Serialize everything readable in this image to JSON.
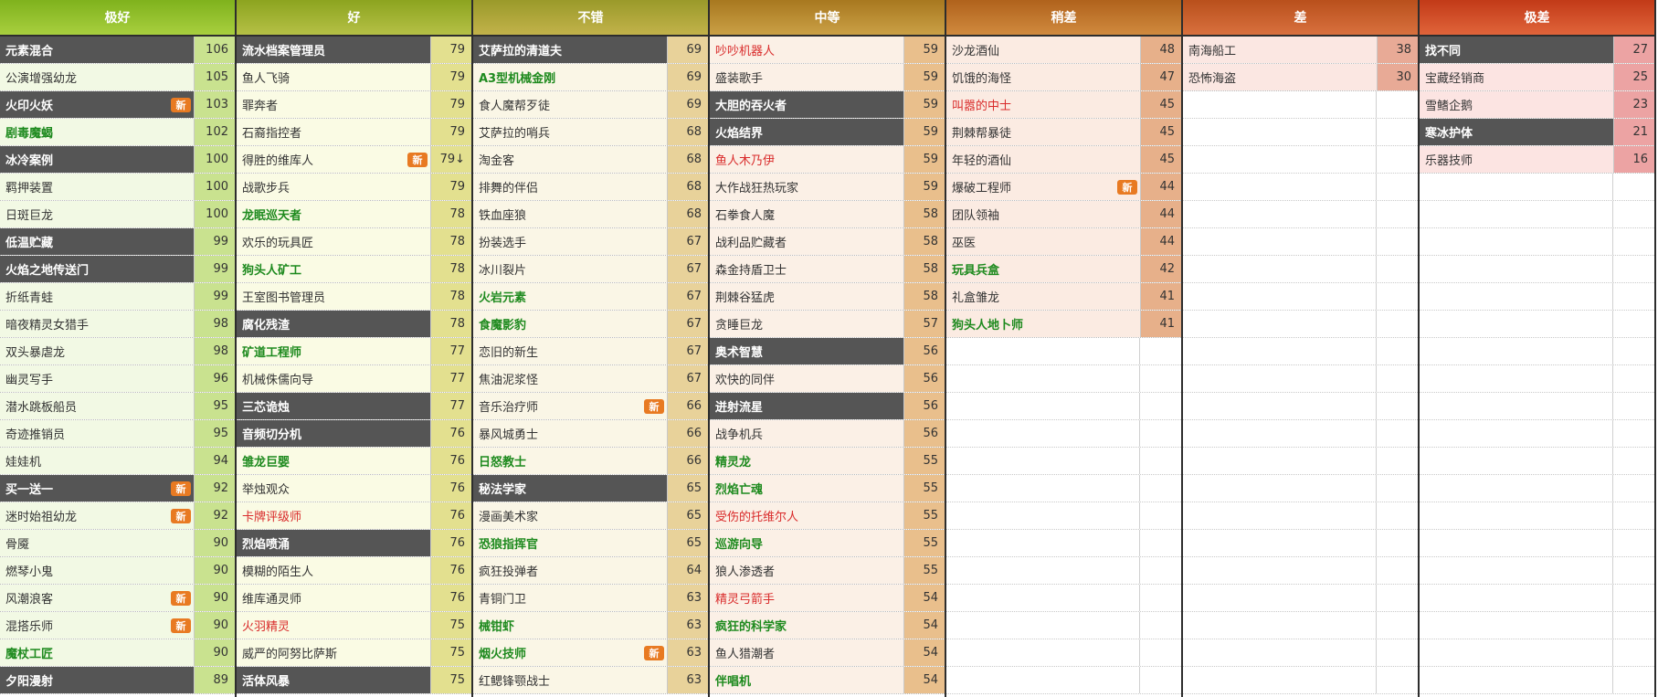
{
  "columns": [
    {
      "title": "极好",
      "header_gradient": [
        "#7fb21d",
        "#a8cf3e"
      ],
      "name_bg": "#f2f9e4",
      "score_bg": "#c9e28f",
      "rows": [
        {
          "name": "元素混合",
          "score": "106",
          "style": "dark",
          "badge": ""
        },
        {
          "name": "公演增强幼龙",
          "score": "105",
          "style": "normal",
          "badge": ""
        },
        {
          "name": "火印火妖",
          "score": "103",
          "style": "dark",
          "badge": "新"
        },
        {
          "name": "剧毒魔蝎",
          "score": "102",
          "style": "green",
          "badge": ""
        },
        {
          "name": "冰冷案例",
          "score": "100",
          "style": "dark",
          "badge": ""
        },
        {
          "name": "羁押装置",
          "score": "100",
          "style": "normal",
          "badge": ""
        },
        {
          "name": "日斑巨龙",
          "score": "100",
          "style": "normal",
          "badge": ""
        },
        {
          "name": "低温贮藏",
          "score": "99",
          "style": "dark",
          "badge": ""
        },
        {
          "name": "火焰之地传送门",
          "score": "99",
          "style": "dark",
          "badge": ""
        },
        {
          "name": "折纸青蛙",
          "score": "99",
          "style": "normal",
          "badge": ""
        },
        {
          "name": "暗夜精灵女猎手",
          "score": "98",
          "style": "normal",
          "badge": ""
        },
        {
          "name": "双头暴虐龙",
          "score": "98",
          "style": "normal",
          "badge": ""
        },
        {
          "name": "幽灵写手",
          "score": "96",
          "style": "normal",
          "badge": ""
        },
        {
          "name": "潜水跳板船员",
          "score": "95",
          "style": "normal",
          "badge": ""
        },
        {
          "name": "奇迹推销员",
          "score": "95",
          "style": "normal",
          "badge": ""
        },
        {
          "name": "娃娃机",
          "score": "94",
          "style": "normal",
          "badge": ""
        },
        {
          "name": "买一送一",
          "score": "92",
          "style": "dark",
          "badge": "新"
        },
        {
          "name": "迷时始祖幼龙",
          "score": "92",
          "style": "normal",
          "badge": "新"
        },
        {
          "name": "骨魇",
          "score": "90",
          "style": "normal",
          "badge": ""
        },
        {
          "name": "燃琴小鬼",
          "score": "90",
          "style": "normal",
          "badge": ""
        },
        {
          "name": "风潮浪客",
          "score": "90",
          "style": "normal",
          "badge": "新"
        },
        {
          "name": "混搭乐师",
          "score": "90",
          "style": "normal",
          "badge": "新"
        },
        {
          "name": "魔杖工匠",
          "score": "90",
          "style": "green",
          "badge": ""
        },
        {
          "name": "夕阳漫射",
          "score": "89",
          "style": "dark",
          "badge": ""
        }
      ]
    },
    {
      "title": "好",
      "header_gradient": [
        "#8ca41f",
        "#b5c045"
      ],
      "name_bg": "#fafbe4",
      "score_bg": "#e3e08f",
      "rows": [
        {
          "name": "流水档案管理员",
          "score": "79",
          "style": "dark",
          "badge": ""
        },
        {
          "name": "鱼人飞骑",
          "score": "79",
          "style": "normal",
          "badge": ""
        },
        {
          "name": "罪奔者",
          "score": "79",
          "style": "normal",
          "badge": ""
        },
        {
          "name": "石裔指控者",
          "score": "79",
          "style": "normal",
          "badge": ""
        },
        {
          "name": "得胜的维库人",
          "score": "79↓",
          "style": "normal",
          "badge": "新"
        },
        {
          "name": "战歌步兵",
          "score": "79",
          "style": "normal",
          "badge": ""
        },
        {
          "name": "龙眠巡天者",
          "score": "78",
          "style": "green",
          "badge": ""
        },
        {
          "name": "欢乐的玩具匠",
          "score": "78",
          "style": "normal",
          "badge": ""
        },
        {
          "name": "狗头人矿工",
          "score": "78",
          "style": "green",
          "badge": ""
        },
        {
          "name": "王室图书管理员",
          "score": "78",
          "style": "normal",
          "badge": ""
        },
        {
          "name": "腐化残渣",
          "score": "78",
          "style": "dark",
          "badge": ""
        },
        {
          "name": "矿道工程师",
          "score": "77",
          "style": "green",
          "badge": ""
        },
        {
          "name": "机械侏儒向导",
          "score": "77",
          "style": "normal",
          "badge": ""
        },
        {
          "name": "三芯诡烛",
          "score": "77",
          "style": "dark",
          "badge": ""
        },
        {
          "name": "音频切分机",
          "score": "76",
          "style": "dark",
          "badge": ""
        },
        {
          "name": "雏龙巨婴",
          "score": "76",
          "style": "green",
          "badge": ""
        },
        {
          "name": "举烛观众",
          "score": "76",
          "style": "normal",
          "badge": ""
        },
        {
          "name": "卡牌评级师",
          "score": "76",
          "style": "red",
          "badge": ""
        },
        {
          "name": "烈焰喷涌",
          "score": "76",
          "style": "dark",
          "badge": ""
        },
        {
          "name": "模糊的陌生人",
          "score": "76",
          "style": "normal",
          "badge": ""
        },
        {
          "name": "维库通灵师",
          "score": "76",
          "style": "normal",
          "badge": ""
        },
        {
          "name": "火羽精灵",
          "score": "75",
          "style": "red",
          "badge": ""
        },
        {
          "name": "威严的阿努比萨斯",
          "score": "75",
          "style": "normal",
          "badge": ""
        },
        {
          "name": "活体风暴",
          "score": "75",
          "style": "dark",
          "badge": ""
        }
      ]
    },
    {
      "title": "不错",
      "header_gradient": [
        "#9a9a2a",
        "#c2b24a"
      ],
      "name_bg": "#faf6e6",
      "score_bg": "#e8d29a",
      "rows": [
        {
          "name": "艾萨拉的清道夫",
          "score": "69",
          "style": "dark",
          "badge": ""
        },
        {
          "name": "A3型机械金刚",
          "score": "69",
          "style": "green",
          "badge": ""
        },
        {
          "name": "食人魔帮歹徒",
          "score": "69",
          "style": "normal",
          "badge": ""
        },
        {
          "name": "艾萨拉的哨兵",
          "score": "68",
          "style": "normal",
          "badge": ""
        },
        {
          "name": "淘金客",
          "score": "68",
          "style": "normal",
          "badge": ""
        },
        {
          "name": "排舞的伴侣",
          "score": "68",
          "style": "normal",
          "badge": ""
        },
        {
          "name": "铁血座狼",
          "score": "68",
          "style": "normal",
          "badge": ""
        },
        {
          "name": "扮装选手",
          "score": "67",
          "style": "normal",
          "badge": ""
        },
        {
          "name": "冰川裂片",
          "score": "67",
          "style": "normal",
          "badge": ""
        },
        {
          "name": "火岩元素",
          "score": "67",
          "style": "green",
          "badge": ""
        },
        {
          "name": "食魔影豹",
          "score": "67",
          "style": "green",
          "badge": ""
        },
        {
          "name": "恋旧的新生",
          "score": "67",
          "style": "normal",
          "badge": ""
        },
        {
          "name": "焦油泥浆怪",
          "score": "67",
          "style": "normal",
          "badge": ""
        },
        {
          "name": "音乐治疗师",
          "score": "66",
          "style": "normal",
          "badge": "新"
        },
        {
          "name": "暴风城勇士",
          "score": "66",
          "style": "normal",
          "badge": ""
        },
        {
          "name": "日怒教士",
          "score": "66",
          "style": "green",
          "badge": ""
        },
        {
          "name": "秘法学家",
          "score": "65",
          "style": "dark",
          "badge": ""
        },
        {
          "name": "漫画美术家",
          "score": "65",
          "style": "normal",
          "badge": ""
        },
        {
          "name": "恐狼指挥官",
          "score": "65",
          "style": "green",
          "badge": ""
        },
        {
          "name": "疯狂投弹者",
          "score": "64",
          "style": "normal",
          "badge": ""
        },
        {
          "name": "青铜门卫",
          "score": "63",
          "style": "normal",
          "badge": ""
        },
        {
          "name": "械钳虾",
          "score": "63",
          "style": "green",
          "badge": ""
        },
        {
          "name": "烟火技师",
          "score": "63",
          "style": "green",
          "badge": "新"
        },
        {
          "name": "红鳃锋颚战士",
          "score": "63",
          "style": "normal",
          "badge": ""
        }
      ]
    },
    {
      "title": "中等",
      "header_gradient": [
        "#a8781f",
        "#caa045"
      ],
      "name_bg": "#fbf0e6",
      "score_bg": "#e9bf8c",
      "rows": [
        {
          "name": "吵吵机器人",
          "score": "59",
          "style": "red",
          "badge": ""
        },
        {
          "name": "盛装歌手",
          "score": "59",
          "style": "normal",
          "badge": ""
        },
        {
          "name": "大胆的吞火者",
          "score": "59",
          "style": "dark",
          "badge": ""
        },
        {
          "name": "火焰结界",
          "score": "59",
          "style": "dark",
          "badge": ""
        },
        {
          "name": "鱼人木乃伊",
          "score": "59",
          "style": "red",
          "badge": ""
        },
        {
          "name": "大作战狂热玩家",
          "score": "59",
          "style": "normal",
          "badge": ""
        },
        {
          "name": "石拳食人魔",
          "score": "58",
          "style": "normal",
          "badge": ""
        },
        {
          "name": "战利品贮藏者",
          "score": "58",
          "style": "normal",
          "badge": ""
        },
        {
          "name": "森金持盾卫士",
          "score": "58",
          "style": "normal",
          "badge": ""
        },
        {
          "name": "荆棘谷猛虎",
          "score": "58",
          "style": "normal",
          "badge": ""
        },
        {
          "name": "贪睡巨龙",
          "score": "57",
          "style": "normal",
          "badge": ""
        },
        {
          "name": "奥术智慧",
          "score": "56",
          "style": "dark",
          "badge": ""
        },
        {
          "name": "欢快的同伴",
          "score": "56",
          "style": "normal",
          "badge": ""
        },
        {
          "name": "迸射流星",
          "score": "56",
          "style": "dark",
          "badge": ""
        },
        {
          "name": "战争机兵",
          "score": "56",
          "style": "normal",
          "badge": ""
        },
        {
          "name": "精灵龙",
          "score": "55",
          "style": "green",
          "badge": ""
        },
        {
          "name": "烈焰亡魂",
          "score": "55",
          "style": "green",
          "badge": ""
        },
        {
          "name": "受伤的托维尔人",
          "score": "55",
          "style": "red",
          "badge": ""
        },
        {
          "name": "巡游向导",
          "score": "55",
          "style": "green",
          "badge": ""
        },
        {
          "name": "狼人渗透者",
          "score": "55",
          "style": "normal",
          "badge": ""
        },
        {
          "name": "精灵弓箭手",
          "score": "54",
          "style": "red",
          "badge": ""
        },
        {
          "name": "疯狂的科学家",
          "score": "54",
          "style": "green",
          "badge": ""
        },
        {
          "name": "鱼人猎潮者",
          "score": "54",
          "style": "normal",
          "badge": ""
        },
        {
          "name": "伴唱机",
          "score": "54",
          "style": "green",
          "badge": ""
        }
      ]
    },
    {
      "title": "稍差",
      "header_gradient": [
        "#b0621c",
        "#d08a3e"
      ],
      "name_bg": "#fbebe2",
      "score_bg": "#e7b08a",
      "rows": [
        {
          "name": "沙龙酒仙",
          "score": "48",
          "style": "normal",
          "badge": ""
        },
        {
          "name": "饥饿的海怪",
          "score": "47",
          "style": "normal",
          "badge": ""
        },
        {
          "name": "叫嚣的中士",
          "score": "45",
          "style": "red",
          "badge": ""
        },
        {
          "name": "荆棘帮暴徒",
          "score": "45",
          "style": "normal",
          "badge": ""
        },
        {
          "name": "年轻的酒仙",
          "score": "45",
          "style": "normal",
          "badge": ""
        },
        {
          "name": "爆破工程师",
          "score": "44",
          "style": "normal",
          "badge": "新"
        },
        {
          "name": "团队领袖",
          "score": "44",
          "style": "normal",
          "badge": ""
        },
        {
          "name": "巫医",
          "score": "44",
          "style": "normal",
          "badge": ""
        },
        {
          "name": "玩具兵盒",
          "score": "42",
          "style": "green",
          "badge": ""
        },
        {
          "name": "礼盒雏龙",
          "score": "41",
          "style": "normal",
          "badge": ""
        },
        {
          "name": "狗头人地卜师",
          "score": "41",
          "style": "green",
          "badge": ""
        }
      ]
    },
    {
      "title": "差",
      "header_gradient": [
        "#b9501c",
        "#d8703e"
      ],
      "name_bg": "#fbe7e2",
      "score_bg": "#e8aa96",
      "rows": [
        {
          "name": "南海船工",
          "score": "38",
          "style": "normal",
          "badge": ""
        },
        {
          "name": "恐怖海盗",
          "score": "30",
          "style": "normal",
          "badge": ""
        }
      ]
    },
    {
      "title": "极差",
      "header_gradient": [
        "#c23a18",
        "#e0643a"
      ],
      "name_bg": "#fce4e2",
      "score_bg": "#eca3a3",
      "rows": [
        {
          "name": "找不同",
          "score": "27",
          "style": "dark",
          "badge": ""
        },
        {
          "name": "宝藏经销商",
          "score": "25",
          "style": "normal",
          "badge": ""
        },
        {
          "name": "雪鳍企鹅",
          "score": "23",
          "style": "normal",
          "badge": ""
        },
        {
          "name": "寒冰护体",
          "score": "21",
          "style": "dark",
          "badge": ""
        },
        {
          "name": "乐器技师",
          "score": "16",
          "style": "normal",
          "badge": ""
        }
      ]
    }
  ]
}
